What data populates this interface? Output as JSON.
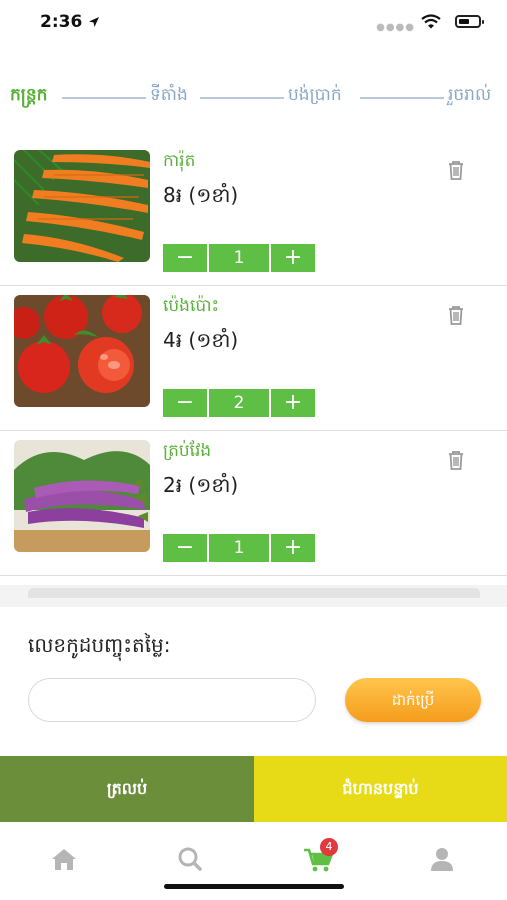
{
  "status": {
    "time": "2:36"
  },
  "steps": [
    "កន្ត្រក",
    "ទីតាំង",
    "បង់ប្រាក់",
    "រួចរាល់"
  ],
  "items": [
    {
      "name": "ការ៉ុត",
      "price": "8៛ (១ខាំ)",
      "qty": "1",
      "image": "carrots"
    },
    {
      "name": "ប៉េងប៉ោះ",
      "price": "4៛ (១ខាំ)",
      "qty": "2",
      "image": "tomatoes"
    },
    {
      "name": "ត្រប់វែង",
      "price": "2៛ (១ខាំ)",
      "qty": "1",
      "image": "eggplants"
    }
  ],
  "qty_controls": {
    "minus": "−",
    "plus": "+"
  },
  "coupon": {
    "title": "លេខកូដបញ្ចុះតម្លៃ:",
    "placeholder": "",
    "apply_label": "ដាក់ប្រើ"
  },
  "actions": {
    "continue_label": "ត្រលប់",
    "order_label": "ជំហានបន្ទាប់"
  },
  "tabbar": {
    "cart_badge": "4"
  },
  "colors": {
    "green": "#5fbf45",
    "olive": "#6b8e3a",
    "yellow": "#e7db17",
    "orange": "#f59c1c",
    "badge": "#e0393e"
  }
}
